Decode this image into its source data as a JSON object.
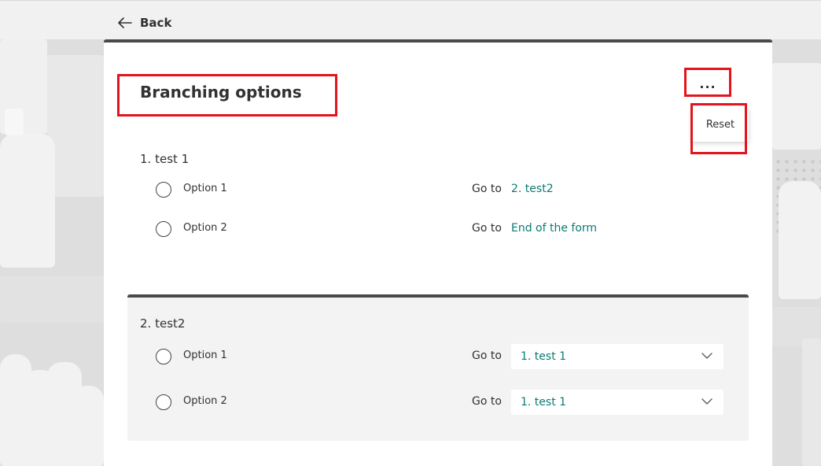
{
  "topbar": {
    "back_label": "Back"
  },
  "page": {
    "title": "Branching options"
  },
  "more_menu": {
    "button_label": "...",
    "items": [
      {
        "label": "Reset"
      }
    ]
  },
  "questions": [
    {
      "title": "1. test 1",
      "options": [
        {
          "label": "Option 1",
          "goto_label": "Go to",
          "target": "2. test2"
        },
        {
          "label": "Option 2",
          "goto_label": "Go to",
          "target": "End of the form"
        }
      ]
    },
    {
      "title": "2. test2",
      "options": [
        {
          "label": "Option 1",
          "goto_label": "Go to",
          "selected": "1. test 1"
        },
        {
          "label": "Option 2",
          "goto_label": "Go to",
          "selected": "1. test 1"
        }
      ]
    }
  ],
  "colors": {
    "accent": "#0b7a75",
    "highlight_box": "#e3141d",
    "panel_border": "#4a4a4a"
  }
}
